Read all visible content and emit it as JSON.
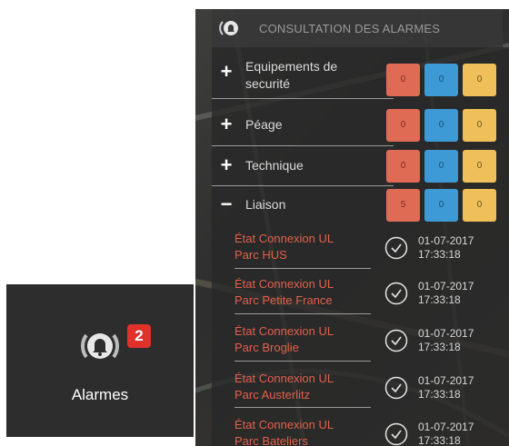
{
  "tile": {
    "label": "Alarmes",
    "badge_count": "2",
    "icon": "bell-icon",
    "badge_color": "#e0312b"
  },
  "panel": {
    "title": "CONSULTATION DES ALARMES",
    "icon": "bell-icon"
  },
  "categories": [
    {
      "sign": "+",
      "name": "Equipements de securité",
      "red": "0",
      "blue": "0",
      "yellow": "0"
    },
    {
      "sign": "+",
      "name": "Péage",
      "red": "0",
      "blue": "0",
      "yellow": "0"
    },
    {
      "sign": "+",
      "name": "Technique",
      "red": "0",
      "blue": "0",
      "yellow": "0"
    },
    {
      "sign": "−",
      "name": "Liaison",
      "red": "5",
      "blue": "0",
      "yellow": "0"
    }
  ],
  "alarms": [
    {
      "line1": "État Connexion UL",
      "line2": "Parc HUS",
      "date": "01-07-2017",
      "time": "17:33:18"
    },
    {
      "line1": "État Connexion UL",
      "line2": "Parc Petite France",
      "date": "01-07-2017",
      "time": "17:33:18"
    },
    {
      "line1": "État Connexion UL",
      "line2": "Parc Broglie",
      "date": "01-07-2017",
      "time": "17:33:18"
    },
    {
      "line1": "État Connexion UL",
      "line2": "Parc Austerlitz",
      "date": "01-07-2017",
      "time": "17:33:18"
    },
    {
      "line1": "État Connexion UL",
      "line2": "Parc Bateliers",
      "date": "01-07-2017",
      "time": "17:33:18"
    }
  ],
  "colors": {
    "count_red": "#e06b55",
    "count_blue": "#3d9ad4",
    "count_yellow": "#efc05a",
    "alarm_text": "#e0614a"
  }
}
